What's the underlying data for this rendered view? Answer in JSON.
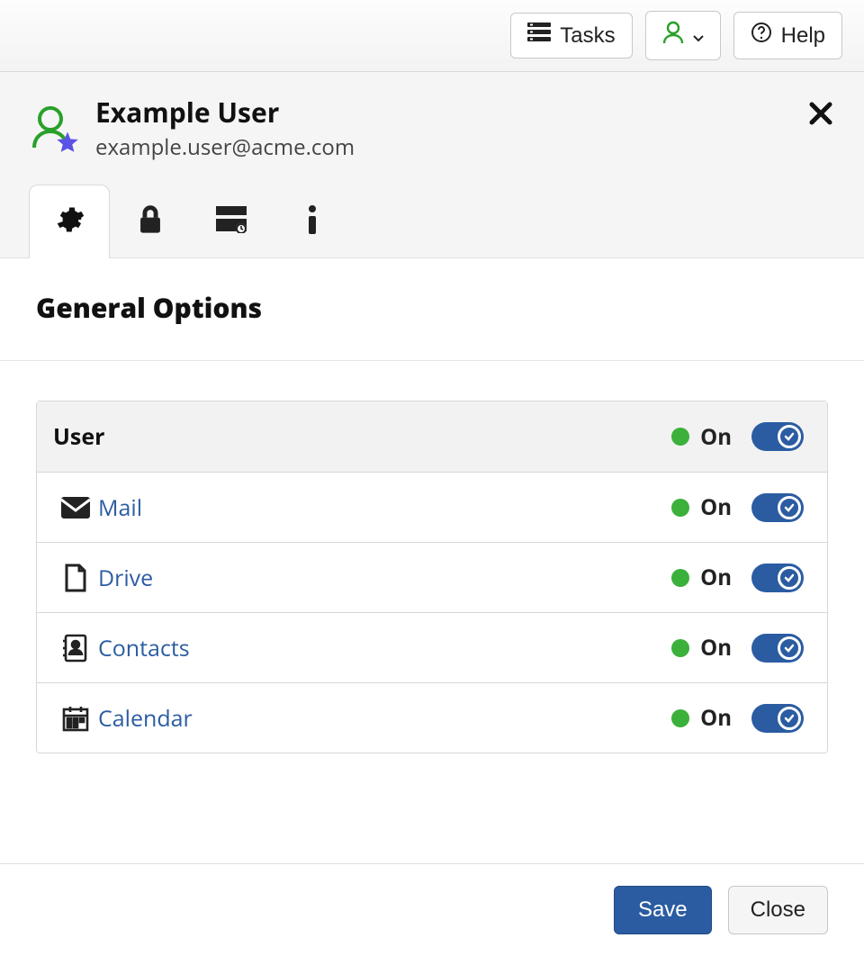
{
  "topbar": {
    "tasks_label": "Tasks",
    "help_label": "Help"
  },
  "header": {
    "user_name": "Example User",
    "user_email": "example.user@acme.com"
  },
  "section": {
    "title": "General Options"
  },
  "status_labels": {
    "on": "On"
  },
  "options": {
    "header_label": "User",
    "items": [
      {
        "icon": "mail-icon",
        "label": "Mail",
        "state": "On",
        "enabled": true
      },
      {
        "icon": "drive-icon",
        "label": "Drive",
        "state": "On",
        "enabled": true
      },
      {
        "icon": "contacts-icon",
        "label": "Contacts",
        "state": "On",
        "enabled": true
      },
      {
        "icon": "calendar-icon",
        "label": "Calendar",
        "state": "On",
        "enabled": true
      }
    ]
  },
  "footer": {
    "save_label": "Save",
    "close_label": "Close"
  }
}
